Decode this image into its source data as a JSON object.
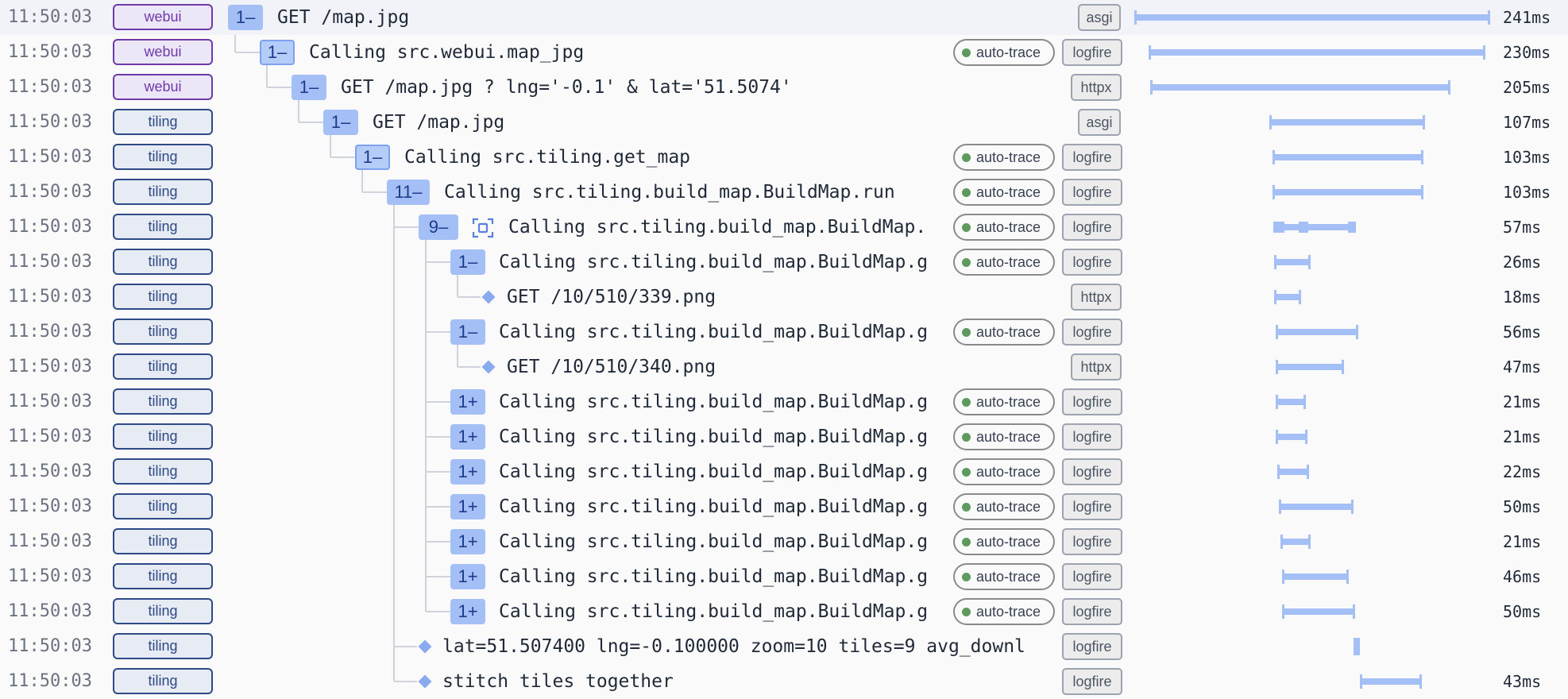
{
  "rows": [
    {
      "time": "11:50:03",
      "service": "webui",
      "toggle": "1–",
      "message": "GET /map.jpg",
      "tags": [
        "asgi"
      ],
      "duration": "241ms"
    },
    {
      "time": "11:50:03",
      "service": "webui",
      "toggle": "1–",
      "message": "Calling src.webui.map_jpg",
      "autotrace": "auto-trace",
      "tags": [
        "logfire"
      ],
      "duration": "230ms"
    },
    {
      "time": "11:50:03",
      "service": "webui",
      "toggle": "1–",
      "message": "GET /map.jpg ? lng='-0.1' & lat='51.5074'",
      "tags": [
        "httpx"
      ],
      "duration": "205ms"
    },
    {
      "time": "11:50:03",
      "service": "tiling",
      "toggle": "1–",
      "message": "GET /map.jpg",
      "tags": [
        "asgi"
      ],
      "duration": "107ms"
    },
    {
      "time": "11:50:03",
      "service": "tiling",
      "toggle": "1–",
      "message": "Calling src.tiling.get_map",
      "autotrace": "auto-trace",
      "tags": [
        "logfire"
      ],
      "duration": "103ms"
    },
    {
      "time": "11:50:03",
      "service": "tiling",
      "toggle": "11–",
      "message": "Calling src.tiling.build_map.BuildMap.run",
      "autotrace": "auto-trace",
      "tags": [
        "logfire"
      ],
      "duration": "103ms"
    },
    {
      "time": "11:50:03",
      "service": "tiling",
      "toggle": "9–",
      "message": "Calling src.tiling.build_map.BuildMap.",
      "autotrace": "auto-trace",
      "tags": [
        "logfire"
      ],
      "duration": "57ms"
    },
    {
      "time": "11:50:03",
      "service": "tiling",
      "toggle": "1–",
      "message": "Calling src.tiling.build_map.BuildMap.g",
      "autotrace": "auto-trace",
      "tags": [
        "logfire"
      ],
      "duration": "26ms"
    },
    {
      "time": "11:50:03",
      "service": "tiling",
      "message": "GET /10/510/339.png",
      "tags": [
        "httpx"
      ],
      "duration": "18ms"
    },
    {
      "time": "11:50:03",
      "service": "tiling",
      "toggle": "1–",
      "message": "Calling src.tiling.build_map.BuildMap.g",
      "autotrace": "auto-trace",
      "tags": [
        "logfire"
      ],
      "duration": "56ms"
    },
    {
      "time": "11:50:03",
      "service": "tiling",
      "message": "GET /10/510/340.png",
      "tags": [
        "httpx"
      ],
      "duration": "47ms"
    },
    {
      "time": "11:50:03",
      "service": "tiling",
      "toggle": "1+",
      "message": "Calling src.tiling.build_map.BuildMap.g",
      "autotrace": "auto-trace",
      "tags": [
        "logfire"
      ],
      "duration": "21ms"
    },
    {
      "time": "11:50:03",
      "service": "tiling",
      "toggle": "1+",
      "message": "Calling src.tiling.build_map.BuildMap.g",
      "autotrace": "auto-trace",
      "tags": [
        "logfire"
      ],
      "duration": "21ms"
    },
    {
      "time": "11:50:03",
      "service": "tiling",
      "toggle": "1+",
      "message": "Calling src.tiling.build_map.BuildMap.g",
      "autotrace": "auto-trace",
      "tags": [
        "logfire"
      ],
      "duration": "22ms"
    },
    {
      "time": "11:50:03",
      "service": "tiling",
      "toggle": "1+",
      "message": "Calling src.tiling.build_map.BuildMap.g",
      "autotrace": "auto-trace",
      "tags": [
        "logfire"
      ],
      "duration": "50ms"
    },
    {
      "time": "11:50:03",
      "service": "tiling",
      "toggle": "1+",
      "message": "Calling src.tiling.build_map.BuildMap.g",
      "autotrace": "auto-trace",
      "tags": [
        "logfire"
      ],
      "duration": "21ms"
    },
    {
      "time": "11:50:03",
      "service": "tiling",
      "toggle": "1+",
      "message": "Calling src.tiling.build_map.BuildMap.g",
      "autotrace": "auto-trace",
      "tags": [
        "logfire"
      ],
      "duration": "46ms"
    },
    {
      "time": "11:50:03",
      "service": "tiling",
      "toggle": "1+",
      "message": "Calling src.tiling.build_map.BuildMap.g",
      "autotrace": "auto-trace",
      "tags": [
        "logfire"
      ],
      "duration": "50ms"
    },
    {
      "time": "11:50:03",
      "service": "tiling",
      "message": "lat=51.507400 lng=-0.100000 zoom=10 tiles=9 avg_downl",
      "tags": [
        "logfire"
      ],
      "duration": ""
    },
    {
      "time": "11:50:03",
      "service": "tiling",
      "message": "stitch tiles together",
      "tags": [
        "logfire"
      ],
      "duration": "43ms"
    }
  ],
  "colors": {
    "webui": "#6f3aa8",
    "tiling": "#2e4a86",
    "span_bar": "#a3bff6",
    "auto_trace_dot": "#5e9a5e"
  },
  "icons": {
    "span_toggle": "expand-collapse-toggle",
    "log_marker": "diamond-icon",
    "focus": "focus-frame-icon"
  }
}
